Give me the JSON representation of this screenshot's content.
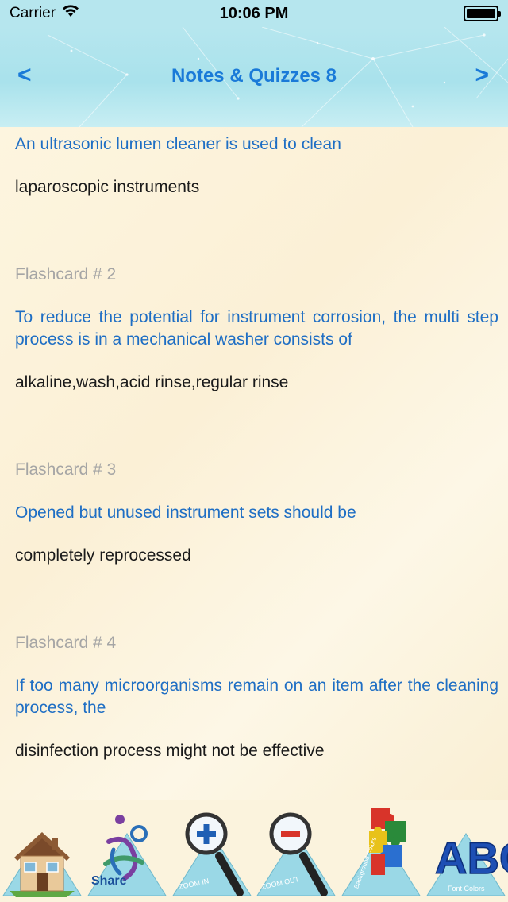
{
  "status_bar": {
    "carrier": "Carrier",
    "time": "10:06 PM"
  },
  "nav": {
    "title": "Notes & Quizzes 8",
    "prev_label": "<",
    "next_label": ">"
  },
  "cards": [
    {
      "label": "",
      "question": "An ultrasonic lumen cleaner is used to clean",
      "answer": "laparoscopic instruments"
    },
    {
      "label": "Flashcard # 2",
      "question": "To reduce the potential for instrument corrosion, the multi step process is in a mechanical washer consists of",
      "answer": "alkaline,wash,acid rinse,regular rinse"
    },
    {
      "label": "Flashcard # 3",
      "question": "Opened but unused instrument sets should be",
      "answer": "completely reprocessed"
    },
    {
      "label": "Flashcard # 4",
      "question": "If too many microorganisms remain on an item after the cleaning process, the",
      "answer": "disinfection process might not be effective"
    }
  ],
  "toolbar": {
    "home_icon": "house-icon",
    "share_label": "Share",
    "zoom_in_label": "ZOOM IN",
    "zoom_out_label": "ZOOM OUT",
    "background_label": "Background Colors",
    "font_label": "Font Colors",
    "font_letters": "ABC"
  },
  "colors": {
    "nav_background": "#b6e6ee",
    "title_blue": "#1a7ad8",
    "question_blue": "#1e6ec4",
    "label_gray": "#a5a5a5",
    "answer_black": "#1a1a1a",
    "page_background": "#fdf6e3"
  }
}
